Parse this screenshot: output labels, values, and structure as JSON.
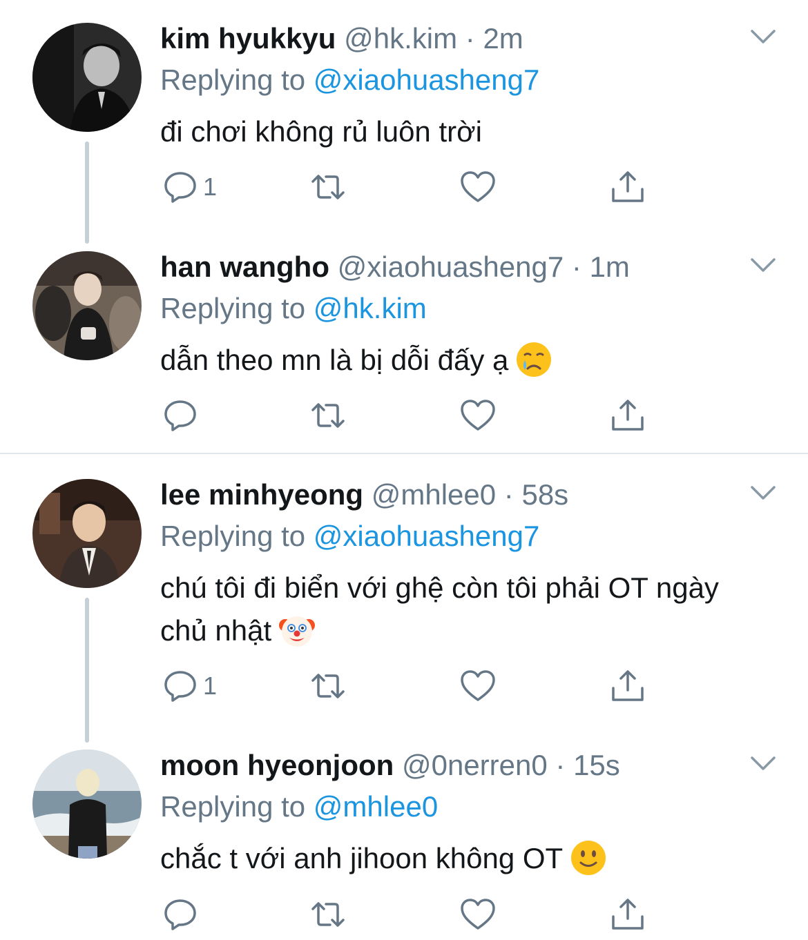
{
  "replying_label": "Replying to",
  "tweets": [
    {
      "name": "kim hyukkyu",
      "handle": "@hk.kim",
      "sep": "·",
      "time": "2m",
      "replying_to": "@xiaohuasheng7",
      "text": "đi chơi không rủ luôn trời",
      "reply_count": "1",
      "emoji": ""
    },
    {
      "name": "han wangho",
      "handle": "@xiaohuasheng7",
      "sep": "·",
      "time": "1m",
      "replying_to": "@hk.kim",
      "text": "dẫn theo mn là bị dỗi đấy ạ",
      "reply_count": "",
      "emoji": "crying-face"
    },
    {
      "name": "lee minhyeong",
      "handle": "@mhlee0",
      "sep": "·",
      "time": "58s",
      "replying_to": "@xiaohuasheng7",
      "text": "chú tôi đi biển với ghệ còn tôi phải OT ngày chủ nhật",
      "reply_count": "1",
      "emoji": "clown-face"
    },
    {
      "name": "moon hyeonjoon",
      "handle": "@0nerren0",
      "sep": "·",
      "time": "15s",
      "replying_to": "@mhlee0",
      "text": "chắc t với anh jihoon không OT",
      "reply_count": "",
      "emoji": "slightly-smiling-face"
    }
  ],
  "icons": {
    "reply": "reply-icon",
    "retweet": "retweet-icon",
    "like": "heart-icon",
    "share": "share-icon",
    "more": "chevron-down-icon"
  },
  "colors": {
    "link": "#1b95e0",
    "secondary": "#657786",
    "text": "#14171a",
    "thread_line": "#c4cfd6",
    "icon": "#657786"
  }
}
